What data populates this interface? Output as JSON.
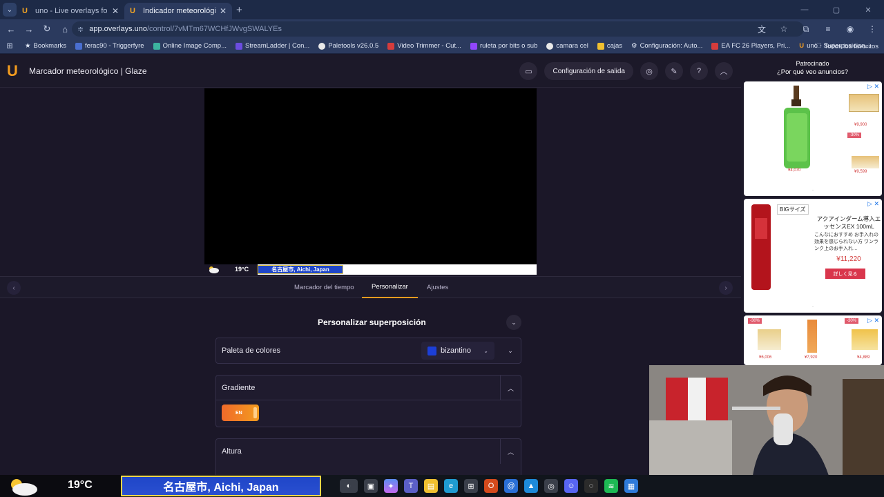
{
  "browser": {
    "tabs": [
      {
        "title": "uno - Live overlays for streamin",
        "active": false
      },
      {
        "title": "Indicador meteorológico | Glaz",
        "active": true
      }
    ],
    "url_host": "app.overlays.uno",
    "url_path": "/control/7vMTm67WCHfJWvgSWALYEs",
    "bookmarks": [
      {
        "label": "Bookmarks",
        "color": "#dfe6f4"
      },
      {
        "label": "ferac90 - Triggerfyre",
        "color": "#4a6fd1"
      },
      {
        "label": "Online Image Comp...",
        "color": "#3cb4a0"
      },
      {
        "label": "StreamLadder | Con...",
        "color": "#6b4de0"
      },
      {
        "label": "Paletools v26.0.5",
        "color": "#e9e9e9"
      },
      {
        "label": "Video Trimmer - Cut...",
        "color": "#d63c3c"
      },
      {
        "label": "ruleta por bits o sub",
        "color": "#9146ff"
      },
      {
        "label": "camara cel",
        "color": "#e9e9e9"
      },
      {
        "label": "cajas",
        "color": "#f0c030"
      },
      {
        "label": "Configuración: Auto...",
        "color": "#e9e9e9"
      },
      {
        "label": "EA FC 26 Players, Pri...",
        "color": "#d63c3c"
      },
      {
        "label": "uno - Superposicion...",
        "color": "#f39c1f"
      }
    ],
    "all_bookmarks": "Todos los favoritos"
  },
  "app": {
    "title": "Marcador meteorológico | Glaze",
    "output_button": "Configuración de salida",
    "help": "?"
  },
  "preview": {
    "temp": "19°C",
    "location": "名古屋市, Aichi, Japan"
  },
  "control_tabs": [
    {
      "label": "Marcador del tiempo",
      "active": false
    },
    {
      "label": "Personalizar",
      "active": true
    },
    {
      "label": "Ajustes",
      "active": false
    }
  ],
  "customize": {
    "title": "Personalizar superposición",
    "palette_label": "Paleta de colores",
    "palette_value": "bizantino",
    "palette_color": "#1c3fd8",
    "gradient_label": "Gradiente",
    "gradient_toggle": "EN",
    "height_label": "Altura"
  },
  "ads": {
    "sponsored": "Patrocinado",
    "why": "¿Por qué veo anuncios?",
    "card1": {
      "price_left": "¥4,070",
      "price_right": "¥9,900",
      "price_right2": "¥9,599",
      "discount": "-30%"
    },
    "card2": {
      "badge": "BIGサイズ",
      "headline": "アクアインダーム導入エッセンスEX 100mL",
      "desc": "こんなにおすすめ お手入れの効果を感じられない方 ワンランク上のお手入れ…",
      "price": "¥11,220",
      "cta": "詳しく見る"
    },
    "card3": {
      "price_a": "¥6,006",
      "price_b": "¥7,920",
      "price_c": "¥4,889",
      "discount_a": "-30%",
      "discount_c": "-30%"
    }
  },
  "taskbar": {
    "temp": "19°C",
    "location": "名古屋市, Aichi, Japan"
  }
}
